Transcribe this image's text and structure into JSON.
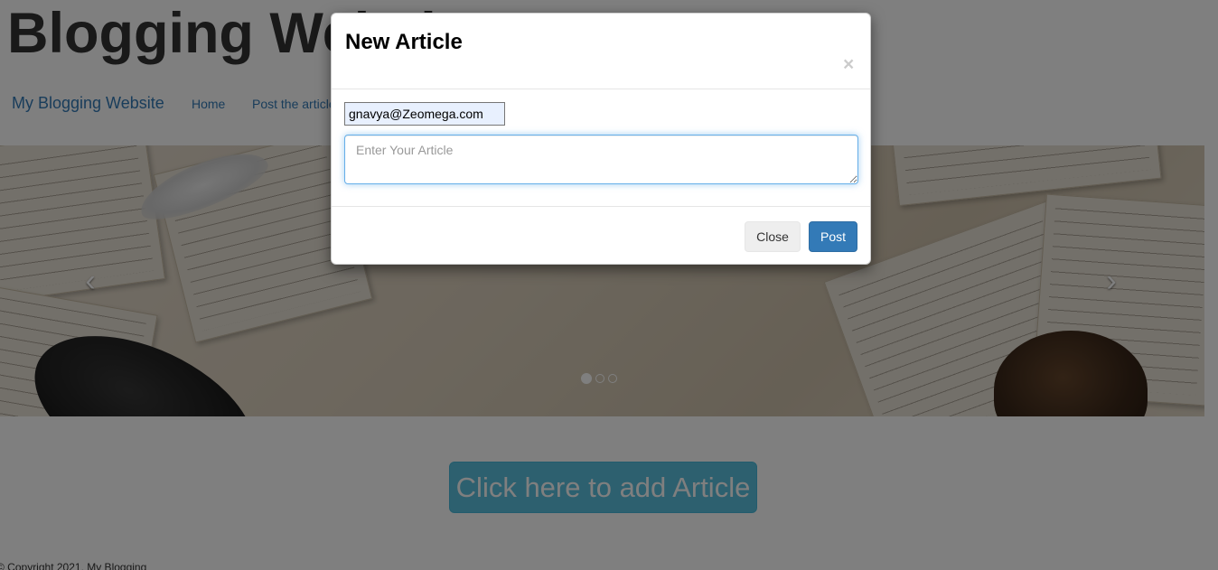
{
  "site": {
    "title": "Blogging Website"
  },
  "navbar": {
    "brand": "My Blogging Website",
    "links": [
      "Home",
      "Post the article"
    ]
  },
  "carousel": {
    "prev_icon": "chevron-left-icon",
    "next_icon": "chevron-right-icon",
    "slide_count": 3,
    "active_slide": 1
  },
  "main": {
    "add_article_label": "Click here to add Article"
  },
  "footer": {
    "copyright": "© Copyright 2021, My Blogging"
  },
  "modal": {
    "title": "New Article",
    "close_symbol": "×",
    "email_value": "gnavya@Zeomega.com",
    "article_placeholder": "Enter Your Article",
    "close_label": "Close",
    "post_label": "Post"
  },
  "colors": {
    "primary": "#337ab7",
    "info": "#5bc0de",
    "backdrop": "rgba(0,0,0,0.5)"
  }
}
